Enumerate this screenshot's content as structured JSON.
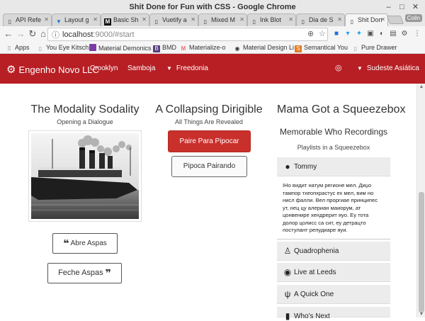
{
  "window": {
    "title": "Shit Done for Fun with CSS - Google Chrome"
  },
  "tabs": [
    {
      "label": "API Refe",
      "icon": "doc-icon"
    },
    {
      "label": "Layout g",
      "icon": "vuetify-icon"
    },
    {
      "label": "Basic Sh",
      "icon": "medium-icon"
    },
    {
      "label": "Vuetify a",
      "icon": "doc-icon"
    },
    {
      "label": "Mixed M",
      "icon": "doc-icon"
    },
    {
      "label": "Ink Blot",
      "icon": "doc-icon"
    },
    {
      "label": "Dia de S",
      "icon": "doc-icon"
    },
    {
      "label": "Shit Don",
      "icon": "doc-icon",
      "active": true
    }
  ],
  "profile": "Colin",
  "address": {
    "host": "localhost",
    "rest": ":9000/#start"
  },
  "bookmarks": [
    {
      "label": "Apps",
      "icon": "apps-icon",
      "color": "#555"
    },
    {
      "label": "You Eye Kitsch",
      "icon": "bookmark-icon",
      "color": "#999"
    },
    {
      "label": "Material Demonics",
      "icon": "purple-icon",
      "color": "#7b3aa6"
    },
    {
      "label": "BMD",
      "icon": "b-icon",
      "color": "#563d7c"
    },
    {
      "label": "Materialize-o",
      "icon": "m-icon",
      "color": "#ee6e73"
    },
    {
      "label": "Material Design Li",
      "icon": "mdl-icon",
      "color": "#333"
    },
    {
      "label": "Semantical You",
      "icon": "s-icon",
      "color": "#e07b24"
    },
    {
      "label": "Pure Drawer",
      "icon": "bookmark-icon",
      "color": "#999"
    }
  ],
  "nav": {
    "brand": "Engenho Novo LLC",
    "links": [
      "Crooklyn",
      "Samboja",
      "Freedonia"
    ],
    "right": "Sudeste Asiática"
  },
  "col1": {
    "title": "The Modality Sodality",
    "subtitle": "Opening a Dialogue",
    "btn1": "Abre Aspas",
    "btn2": "Feche Aspas"
  },
  "col2": {
    "title": "A Collapsing Dirigible",
    "subtitle": "All Things Are Revealed",
    "btn_primary": "Paire Para Pipocar",
    "btn_secondary": "Pipoca Pairando"
  },
  "col3": {
    "title": "Mama Got a Squeezebox",
    "heading": "Memorable Who Recordings",
    "subheading": "Playlists in a Squeezebox",
    "items": [
      {
        "label": "Tommy",
        "icon": "apple-icon"
      },
      {
        "label": "Quadrophenia",
        "icon": "linux-icon"
      },
      {
        "label": "Live at Leeds",
        "icon": "vinyl-icon"
      },
      {
        "label": "A Quick One",
        "icon": "cutlery-icon"
      },
      {
        "label": "Who's Next",
        "icon": "chart-icon"
      }
    ],
    "body": "IНо видит натум регионе мел. Диџо тампор тхеопхрастус ех мел, вим но нисл фалли. Вел проргиае принципес ут, нец цу алериан маиорум, ат цонвенире хендрерит яуо. Еу тота долор цолисс са сит, еу детрацто постулант репудиаре яуи."
  }
}
